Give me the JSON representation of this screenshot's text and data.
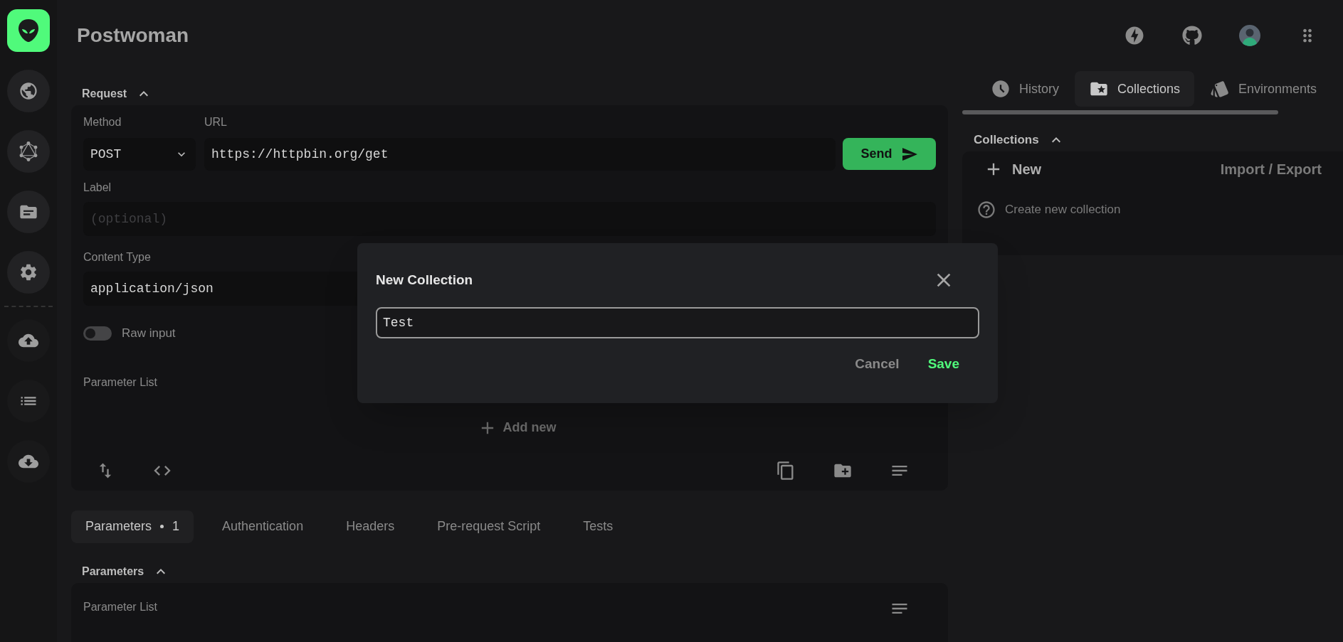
{
  "app": {
    "title": "Postwoman"
  },
  "request": {
    "title": "Request",
    "expanded": true,
    "method_label": "Method",
    "method": "POST",
    "url_label": "URL",
    "url": "https://httpbin.org/get",
    "send": "Send",
    "label_label": "Label",
    "label_placeholder": "(optional)",
    "content_type_label": "Content Type",
    "content_type": "application/json",
    "raw_input": {
      "label": "Raw input",
      "on": false
    },
    "parameter_list_label": "Parameter List",
    "add_new": "Add new"
  },
  "tabs": [
    {
      "label": "Parameters",
      "badge": "1",
      "selected": true
    },
    {
      "label": "Authentication",
      "selected": false
    },
    {
      "label": "Headers",
      "selected": false
    },
    {
      "label": "Pre-request Script",
      "selected": false
    },
    {
      "label": "Tests",
      "selected": false
    }
  ],
  "parameters": {
    "title": "Parameters",
    "expanded": true,
    "parameter_list_label": "Parameter List"
  },
  "side_tabs": [
    {
      "kind": "history",
      "label": "History",
      "selected": false
    },
    {
      "kind": "collections",
      "label": "Collections",
      "selected": true
    },
    {
      "kind": "environments",
      "label": "Environments",
      "selected": false
    }
  ],
  "collections": {
    "title": "Collections",
    "expanded": true,
    "new": "New",
    "import_export": "Import / Export",
    "hint": "Create new collection"
  },
  "dialog": {
    "title": "New Collection",
    "value": "Test",
    "cancel": "Cancel",
    "save": "Save"
  }
}
